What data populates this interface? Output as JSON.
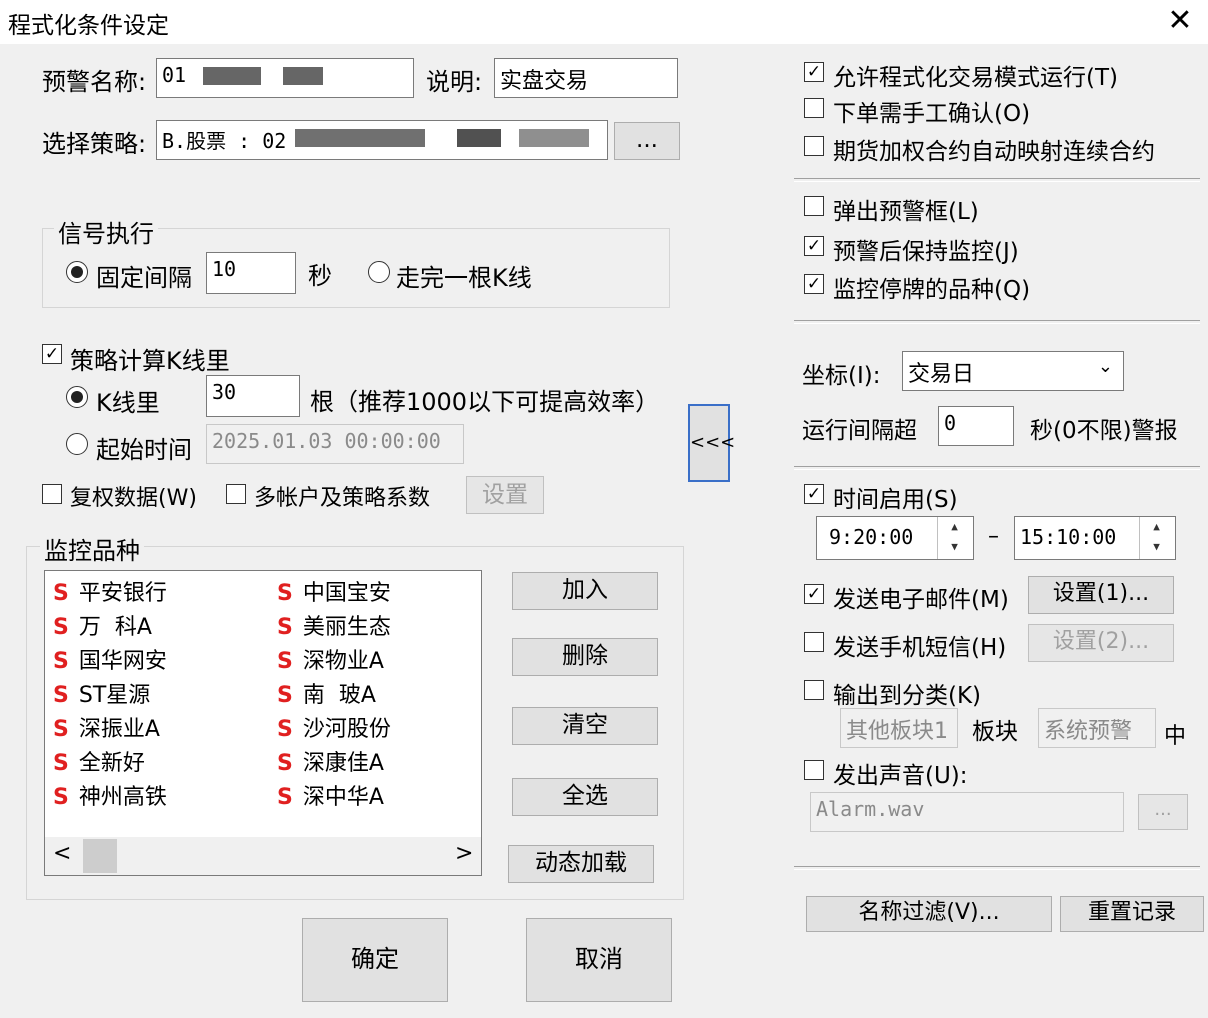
{
  "window": {
    "title": "程式化条件设定"
  },
  "alert_name": {
    "label": "预警名称:",
    "value": "01"
  },
  "description": {
    "label": "说明:",
    "value": "实盘交易"
  },
  "strategy": {
    "label": "选择策略:",
    "value": "B.股票 : 02",
    "browse_label": "..."
  },
  "signal": {
    "group_label": "信号执行",
    "fixed_interval_label": "固定间隔",
    "interval_value": "10",
    "sec_label": "秒",
    "kline_complete_label": "走完一根K线",
    "selected": "fixed_interval"
  },
  "kline": {
    "calc_label": "策略计算K线里",
    "calc_checked": true,
    "count_label": "K线里",
    "count_value": "30",
    "count_hint": "根（推荐1000以下可提高效率）",
    "start_label": "起始时间",
    "start_value": "2025.01.03 00:00:00",
    "selected": "count"
  },
  "options": {
    "adjusted_label": "复权数据(W)",
    "adjusted_checked": false,
    "multi_account_label": "多帐户及策略系数",
    "multi_account_checked": false,
    "settings_label": "设置"
  },
  "monitor": {
    "group_label": "监控品种",
    "stocks_left": [
      "平安银行",
      "万  科A",
      "国华网安",
      "ST星源",
      "深振业A",
      "全新好",
      "神州高铁"
    ],
    "stocks_right": [
      "中国宝安",
      "美丽生态",
      "深物业A",
      "南  玻A",
      "沙河股份",
      "深康佳A",
      "深中华A"
    ],
    "marker": "S",
    "marker_color": "#e02020",
    "scroll_left": "<",
    "scroll_right": ">",
    "add_label": "加入",
    "delete_label": "删除",
    "clear_label": "清空",
    "select_all_label": "全选",
    "dynamic_load_label": "动态加载"
  },
  "ok_label": "确定",
  "cancel_label": "取消",
  "collapse_label": "<<<",
  "right": {
    "allow_auto_trade": {
      "label": "允许程式化交易模式运行(T)",
      "checked": true
    },
    "manual_confirm": {
      "label": "下单需手工确认(O)",
      "checked": false
    },
    "futures_map": {
      "label": "期货加权合约自动映射连续合约",
      "checked": false
    },
    "popup_alert": {
      "label": "弹出预警框(L)",
      "checked": false
    },
    "keep_monitor": {
      "label": "预警后保持监控(J)",
      "checked": true
    },
    "monitor_suspended": {
      "label": "监控停牌的品种(Q)",
      "checked": true
    },
    "axis_label": "坐标(I):",
    "axis_value": "交易日",
    "run_interval_label": "运行间隔超",
    "run_interval_value": "0",
    "run_interval_suffix": "秒(0不限)警报",
    "time_enable": {
      "label": "时间启用(S)",
      "checked": true
    },
    "time_start": "9:20:00",
    "time_dash": "–",
    "time_end": "15:10:00",
    "spin_up": "▲",
    "spin_down": "▼",
    "send_email": {
      "label": "发送电子邮件(M)",
      "checked": true,
      "settings": "设置(1)..."
    },
    "send_sms": {
      "label": "发送手机短信(H)",
      "checked": false,
      "settings": "设置(2)..."
    },
    "output_category": {
      "label": "输出到分类(K)",
      "checked": false
    },
    "category_block": "其他板块1",
    "block_label": "板块",
    "category_alert": "系统预警",
    "middle_label": "中",
    "sound": {
      "label": "发出声音(U):",
      "checked": false
    },
    "sound_file": "Alarm.wav",
    "sound_browse": "...",
    "name_filter_label": "名称过滤(V)...",
    "reset_record_label": "重置记录"
  }
}
